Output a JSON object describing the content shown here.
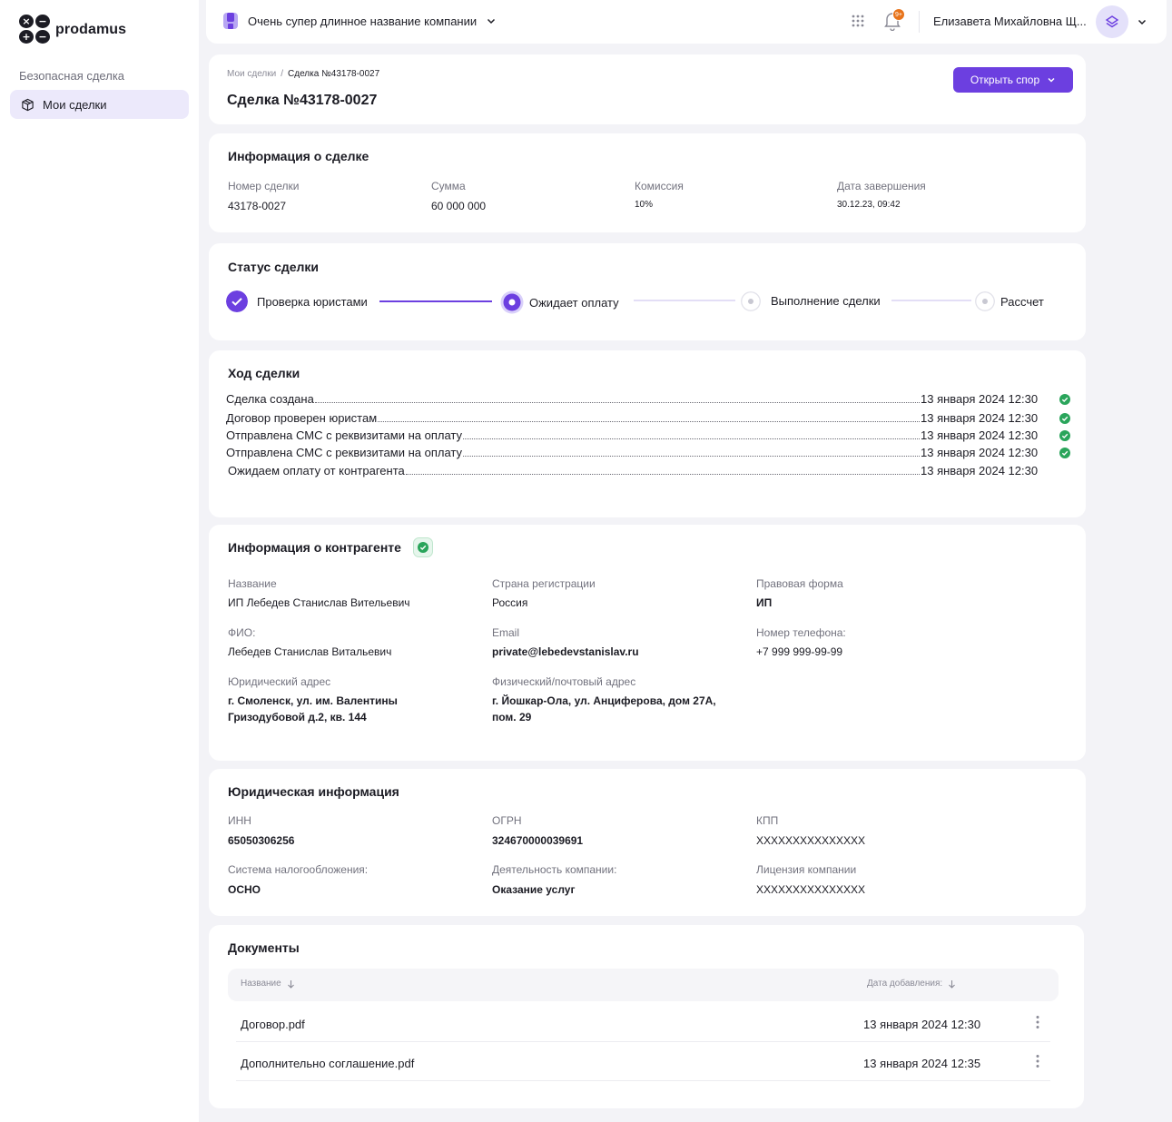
{
  "sidebar": {
    "logo_text": "prodamus",
    "logo_glyphs": [
      "×",
      "−",
      "+",
      "−"
    ],
    "section": "Безопасная сделка",
    "items": [
      {
        "label": "Мои сделки",
        "icon": "box-icon",
        "active": true
      }
    ]
  },
  "topbar": {
    "company_name": "Очень супер длинное название компании",
    "notifications_badge": "9+",
    "user_name": "Елизавета Михайловна Щ...",
    "accent": "#6c3fe0"
  },
  "header": {
    "breadcrumb": [
      "Мои сделки",
      "Сделка №43178-0027"
    ],
    "breadcrumb_sep": "/",
    "title": "Сделка №43178-0027",
    "dispute_button": "Открыть спор"
  },
  "deal_info": {
    "title": "Информация о сделке",
    "fields": [
      {
        "label": "Номер сделки",
        "value": "43178-0027"
      },
      {
        "label": "Сумма",
        "value": "60 000 000"
      },
      {
        "label": "Комиссия",
        "value": "10%"
      },
      {
        "label": "Дата завершения",
        "value": "30.12.23, 09:42"
      }
    ]
  },
  "status": {
    "title": "Статус сделки",
    "steps": [
      {
        "label": "Проверка юристами",
        "state": "done"
      },
      {
        "label": "Ожидает оплату",
        "state": "current"
      },
      {
        "label": "Выполнение сделки",
        "state": "pending"
      },
      {
        "label": "Рассчет",
        "state": "pending"
      }
    ]
  },
  "progress": {
    "title": "Ход сделки",
    "items": [
      {
        "text": "Сделка создана",
        "date": "13 января 2024 12:30",
        "done": true
      },
      {
        "text": "Договор проверен юристам",
        "date": "13 января 2024 12:30",
        "done": true
      },
      {
        "text": "Отправлена СМС с реквизитами на оплату",
        "date": "13 января 2024 12:30",
        "done": true
      },
      {
        "text": "Отправлена СМС с реквизитами на оплату",
        "date": "13 января 2024 12:30",
        "done": true
      },
      {
        "text": "Ожидаем оплату от контрагента",
        "date": "13 января 2024 12:30",
        "done": false
      }
    ]
  },
  "counterparty": {
    "title": "Информация о контрагенте",
    "verified": true,
    "fields": {
      "name": {
        "label": "Название",
        "value": "ИП Лебедев Станислав Вительевич"
      },
      "country": {
        "label": "Страна регистрации",
        "value": "Россия"
      },
      "legal_form": {
        "label": "Правовая форма",
        "value": "ИП"
      },
      "fio": {
        "label": "ФИО:",
        "value": "Лебедев Станислав Витальевич"
      },
      "email": {
        "label": "Email",
        "value": "private@lebedevstanislav.ru"
      },
      "phone": {
        "label": "Номер телефона:",
        "value": "+7 999 999-99-99"
      },
      "legal_address": {
        "label": "Юридический адрес",
        "line1": "г. Смоленск, ул. им. Валентины",
        "line2": "Гризодубовой д.2, кв. 144"
      },
      "postal_address": {
        "label": "Физический/почтовый адрес",
        "line1": "г. Йошкар-Ола, ул. Анциферова, дом 27А,",
        "line2": "пом. 29"
      }
    }
  },
  "legal": {
    "title": "Юридическая информация",
    "fields": {
      "inn": {
        "label": "ИНН",
        "value": "65050306256"
      },
      "ogrn": {
        "label": "ОГРН",
        "value": "324670000039691"
      },
      "kpp": {
        "label": "КПП",
        "value": "XXXXXXXXXXXXXXX"
      },
      "tax": {
        "label": "Система налогообложения:",
        "value": "ОСНО"
      },
      "activity": {
        "label": "Деятельность компании:",
        "value": "Оказание услуг"
      },
      "license": {
        "label": "Лицензия компании",
        "value": "XXXXXXXXXXXXXXX"
      }
    }
  },
  "documents": {
    "title": "Документы",
    "columns": [
      "Название",
      "Дата добавления:"
    ],
    "rows": [
      {
        "name": "Договор.pdf",
        "date": "13 января 2024 12:30"
      },
      {
        "name": "Дополнительно соглашение.pdf",
        "date": "13 января 2024 12:35"
      }
    ]
  }
}
